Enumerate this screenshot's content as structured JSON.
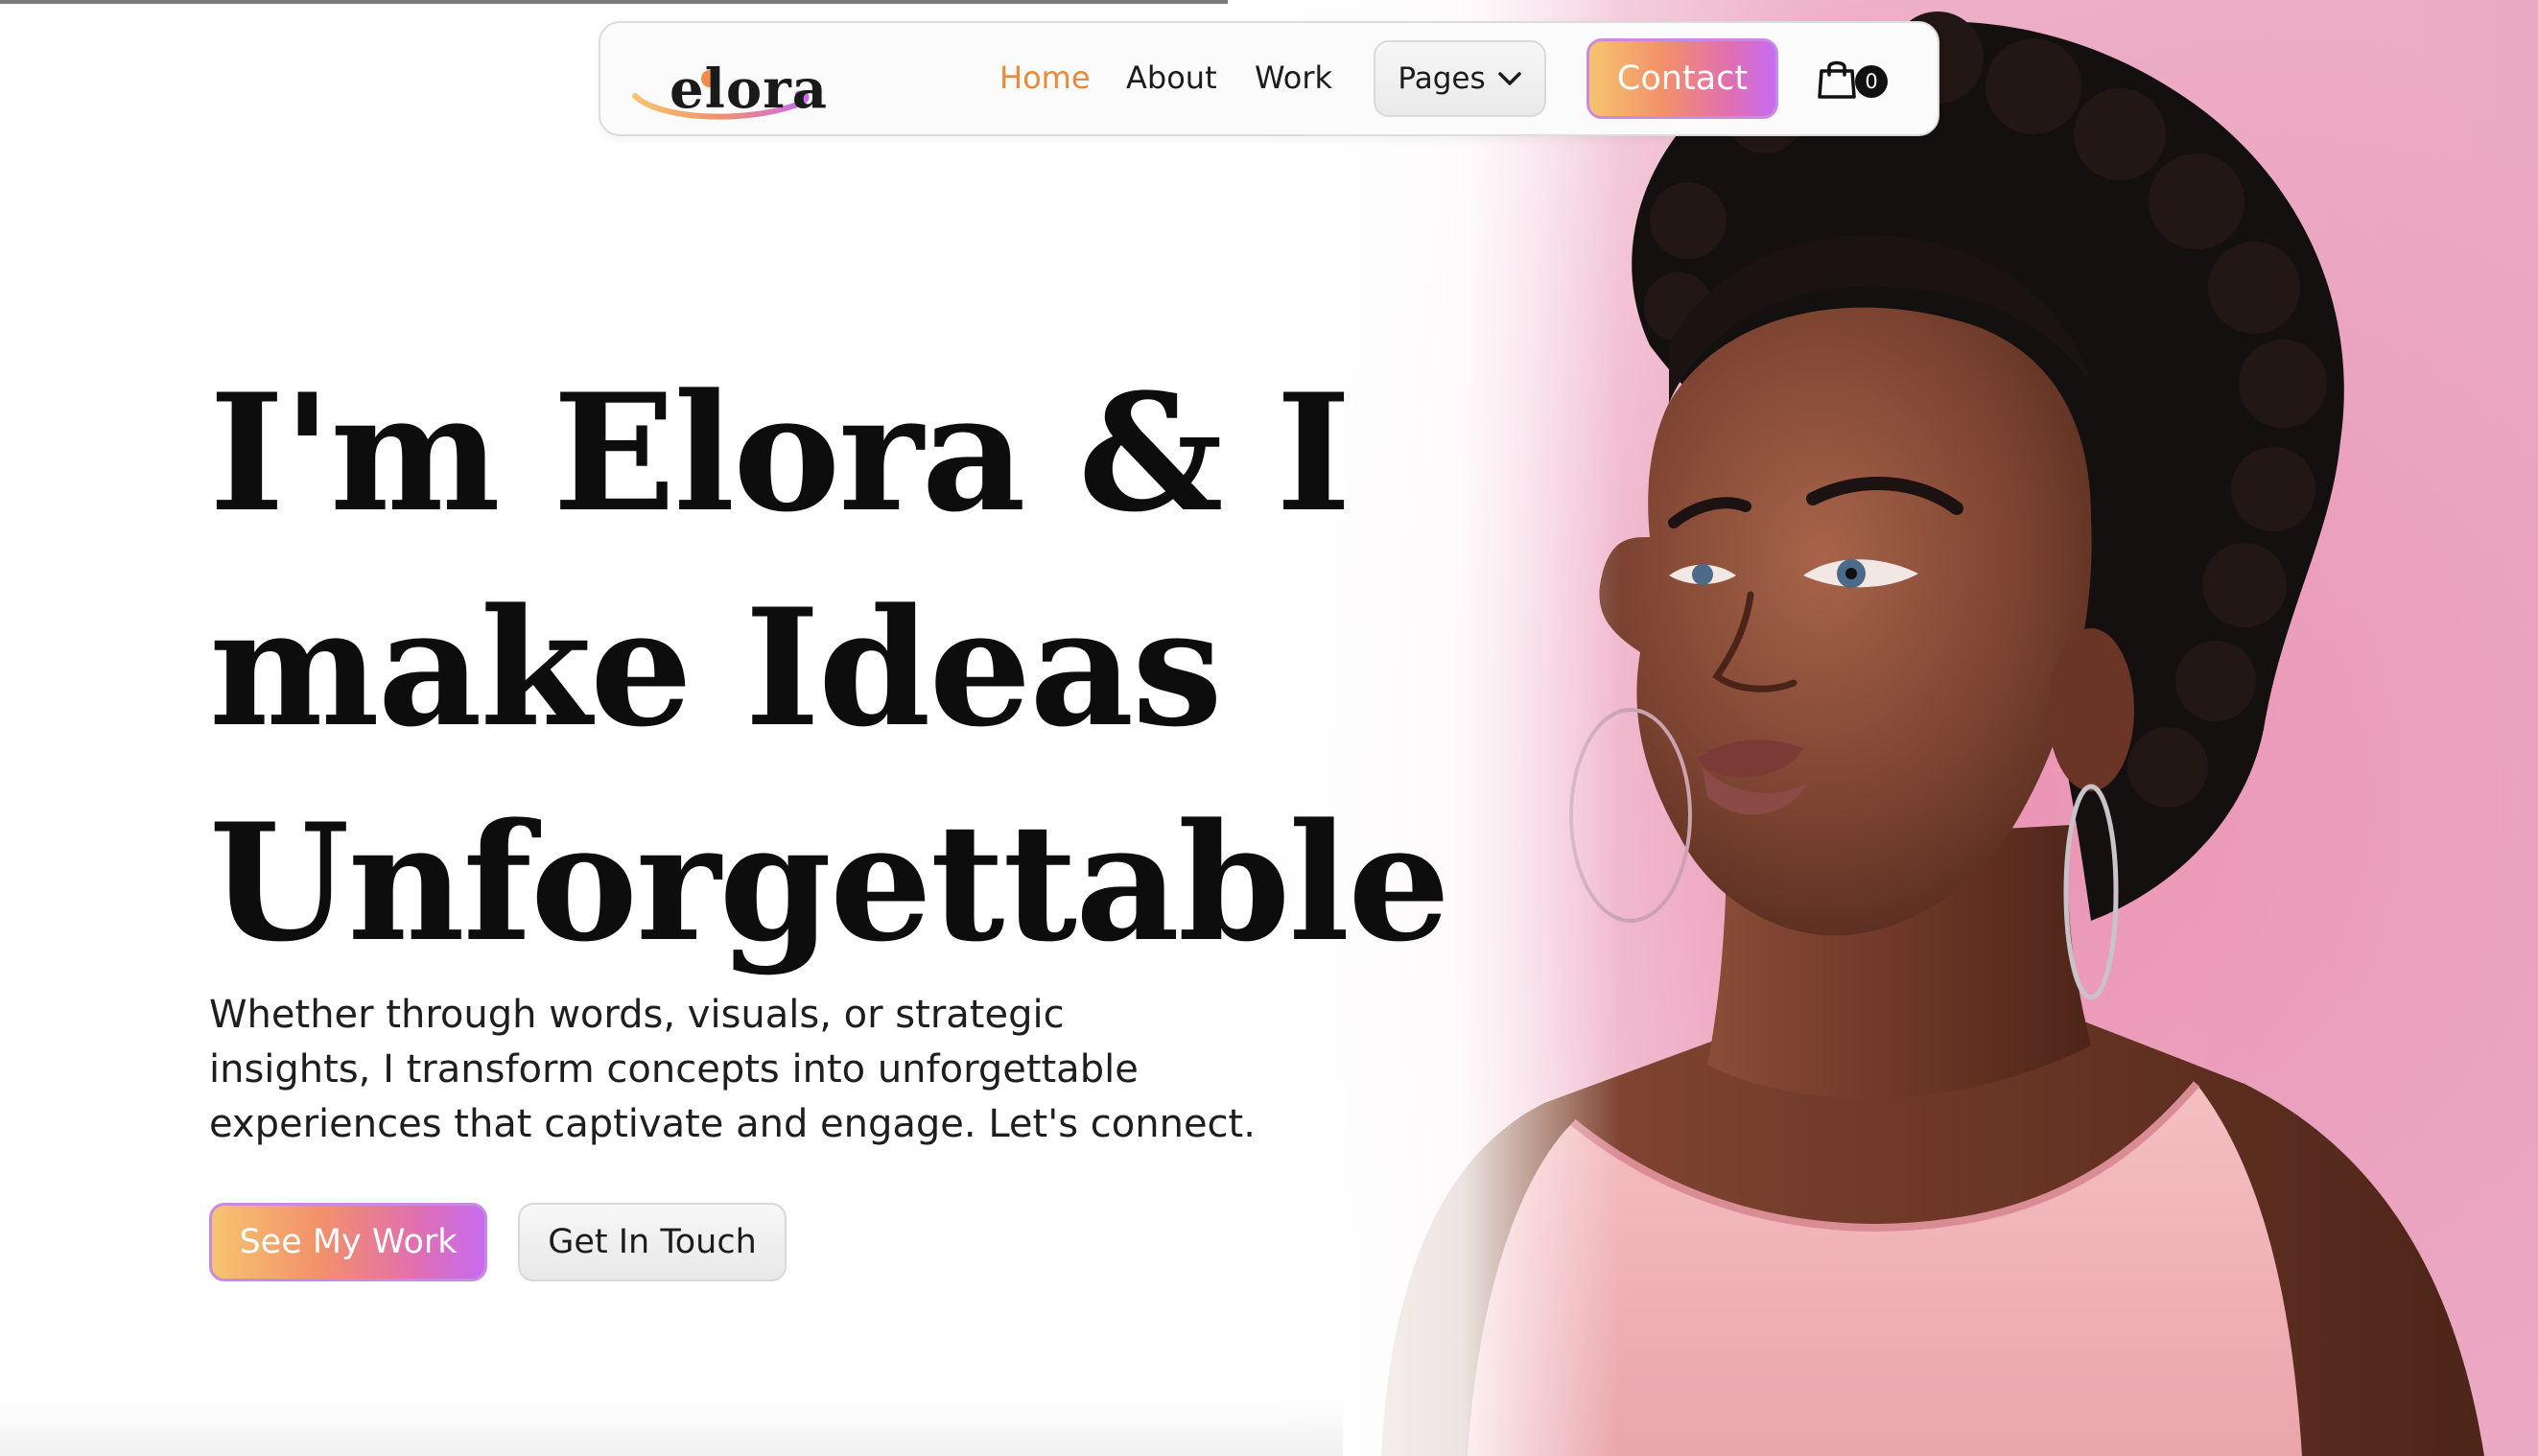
{
  "brand": {
    "logo_text": "elora"
  },
  "nav": {
    "links": [
      {
        "label": "Home",
        "active": true
      },
      {
        "label": "About",
        "active": false
      },
      {
        "label": "Work",
        "active": false
      }
    ],
    "pages_label": "Pages",
    "contact_label": "Contact",
    "cart_count": "0"
  },
  "hero": {
    "headline_lines": [
      "I'm Elora & I",
      "make Ideas",
      "Unforgettable"
    ],
    "subtext_lines": [
      "Whether through words, visuals, or strategic",
      "insights, I transform concepts into unforgettable",
      "experiences that captivate and engage. Let's connect."
    ],
    "primary_button": "See My Work",
    "secondary_button": "Get In Touch"
  },
  "icons": {
    "pages_dropdown": "chevron-down-icon",
    "cart": "shopping-bag-icon"
  },
  "colors": {
    "accent_orange": "#e98a3a",
    "gradient_start": "#f6c46f",
    "gradient_mid": "#f2906a",
    "gradient_pink": "#e06fb0",
    "gradient_end": "#c76bf0",
    "hero_background_pink": "#e9a3c0",
    "text_dark": "#0d0d0d"
  }
}
